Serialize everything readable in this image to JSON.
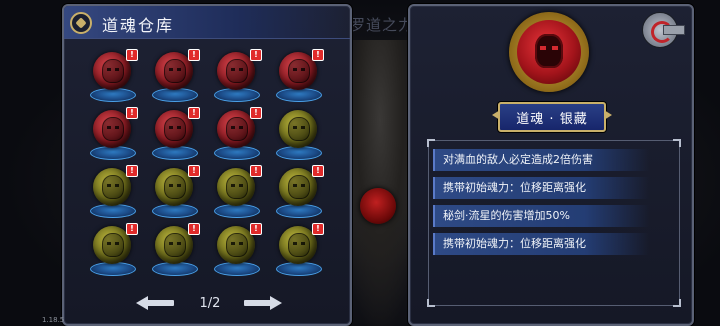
{
  "version": "1.18.5",
  "background": {
    "title_fragment": "罗道之力"
  },
  "inventory": {
    "title": "道魂仓库",
    "orbs": [
      {
        "color": "red",
        "new": true
      },
      {
        "color": "red",
        "new": true
      },
      {
        "color": "red",
        "new": true
      },
      {
        "color": "red",
        "new": true
      },
      {
        "color": "red",
        "new": true
      },
      {
        "color": "red",
        "new": true
      },
      {
        "color": "red",
        "new": true
      },
      {
        "color": "yellow",
        "new": false
      },
      {
        "color": "yellow",
        "new": true
      },
      {
        "color": "yellow",
        "new": true
      },
      {
        "color": "yellow",
        "new": true
      },
      {
        "color": "yellow",
        "new": true
      },
      {
        "color": "yellow",
        "new": true
      },
      {
        "color": "yellow",
        "new": true
      },
      {
        "color": "yellow",
        "new": true
      },
      {
        "color": "yellow",
        "new": true
      }
    ],
    "badge_symbol": "!",
    "page": "1/2"
  },
  "detail": {
    "name": "道魂 · 银藏",
    "effects": [
      "对满血的敌人必定造成2倍伤害",
      "携带初始魂力：位移距离强化",
      "秘剑·流星的伤害增加50%",
      "携带初始魂力：位移距离强化"
    ]
  },
  "colors": {
    "panel_border": "#5b6276",
    "title_bar": "#354880",
    "accent_gold": "#c9b06a",
    "orb_red": "#a3141b",
    "orb_yellow": "#6b6a1a",
    "stand_blue": "#2f7cc4"
  }
}
